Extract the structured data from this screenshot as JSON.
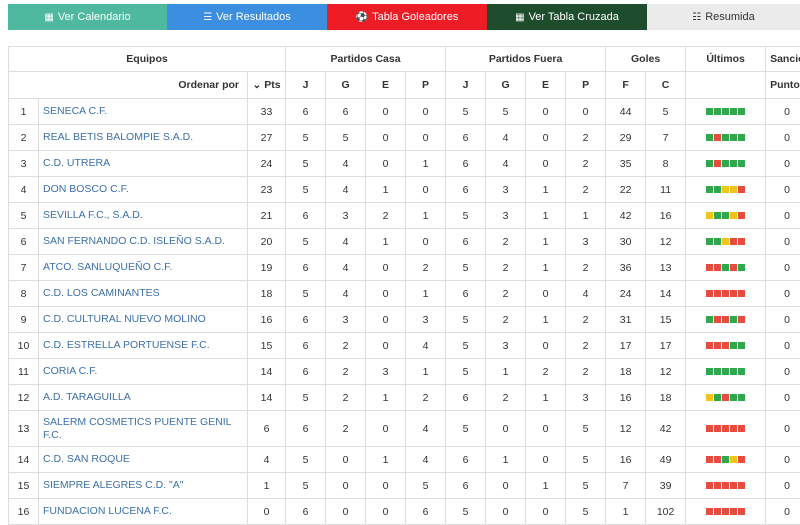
{
  "nav": [
    {
      "label": "Ver Calendario",
      "icon": "calendar-icon",
      "glyph": "▦"
    },
    {
      "label": "Ver Resultados",
      "icon": "list-icon",
      "glyph": "☰"
    },
    {
      "label": "Tabla Goleadores",
      "icon": "ball-icon",
      "glyph": "⚽"
    },
    {
      "label": "Ver Tabla Cruzada",
      "icon": "grid-icon",
      "glyph": "▦"
    },
    {
      "label": "Resumida",
      "icon": "list-alt-icon",
      "glyph": "☷"
    }
  ],
  "headers": {
    "equipos": "Equipos",
    "casa": "Partidos Casa",
    "fuera": "Partidos Fuera",
    "goles": "Goles",
    "ultimos": "Últimos",
    "sancion": "Sanción",
    "ordenar": "Ordenar por",
    "pts": "Pts",
    "sort_glyph": "⌄",
    "j": "J",
    "g": "G",
    "e": "E",
    "p": "P",
    "f": "F",
    "c": "C",
    "puntos": "Puntos"
  },
  "rows": [
    {
      "pos": "1",
      "team": "SENECA C.F.",
      "pts": "33",
      "hj": "6",
      "hg": "6",
      "he": "0",
      "hp": "0",
      "aj": "5",
      "ag": "5",
      "ae": "0",
      "ap": "0",
      "f": "44",
      "c": "5",
      "last": [
        "G",
        "G",
        "G",
        "G",
        "G"
      ],
      "san": "0"
    },
    {
      "pos": "2",
      "team": "REAL BETIS BALOMPIE S.A.D.",
      "pts": "27",
      "hj": "5",
      "hg": "5",
      "he": "0",
      "hp": "0",
      "aj": "6",
      "ag": "4",
      "ae": "0",
      "ap": "2",
      "f": "29",
      "c": "7",
      "last": [
        "G",
        "P",
        "G",
        "G",
        "G"
      ],
      "san": "0"
    },
    {
      "pos": "3",
      "team": "C.D. UTRERA",
      "pts": "24",
      "hj": "5",
      "hg": "4",
      "he": "0",
      "hp": "1",
      "aj": "6",
      "ag": "4",
      "ae": "0",
      "ap": "2",
      "f": "35",
      "c": "8",
      "last": [
        "G",
        "P",
        "G",
        "G",
        "G"
      ],
      "san": "0"
    },
    {
      "pos": "4",
      "team": "DON BOSCO C.F.",
      "pts": "23",
      "hj": "5",
      "hg": "4",
      "he": "1",
      "hp": "0",
      "aj": "6",
      "ag": "3",
      "ae": "1",
      "ap": "2",
      "f": "22",
      "c": "11",
      "last": [
        "G",
        "G",
        "E",
        "E",
        "P"
      ],
      "san": "0"
    },
    {
      "pos": "5",
      "team": "SEVILLA F.C., S.A.D.",
      "pts": "21",
      "hj": "6",
      "hg": "3",
      "he": "2",
      "hp": "1",
      "aj": "5",
      "ag": "3",
      "ae": "1",
      "ap": "1",
      "f": "42",
      "c": "16",
      "last": [
        "E",
        "G",
        "G",
        "E",
        "P"
      ],
      "san": "0"
    },
    {
      "pos": "6",
      "team": "SAN FERNANDO C.D. ISLEÑO S.A.D.",
      "pts": "20",
      "hj": "5",
      "hg": "4",
      "he": "1",
      "hp": "0",
      "aj": "6",
      "ag": "2",
      "ae": "1",
      "ap": "3",
      "f": "30",
      "c": "12",
      "last": [
        "G",
        "G",
        "E",
        "P",
        "P"
      ],
      "san": "0"
    },
    {
      "pos": "7",
      "team": "ATCO. SANLUQUEÑO C.F.",
      "pts": "19",
      "hj": "6",
      "hg": "4",
      "he": "0",
      "hp": "2",
      "aj": "5",
      "ag": "2",
      "ae": "1",
      "ap": "2",
      "f": "36",
      "c": "13",
      "last": [
        "P",
        "P",
        "G",
        "P",
        "G"
      ],
      "san": "0"
    },
    {
      "pos": "8",
      "team": "C.D. LOS CAMINANTES",
      "pts": "18",
      "hj": "5",
      "hg": "4",
      "he": "0",
      "hp": "1",
      "aj": "6",
      "ag": "2",
      "ae": "0",
      "ap": "4",
      "f": "24",
      "c": "14",
      "last": [
        "P",
        "P",
        "P",
        "P",
        "P"
      ],
      "san": "0"
    },
    {
      "pos": "9",
      "team": "C.D. CULTURAL NUEVO MOLINO",
      "pts": "16",
      "hj": "6",
      "hg": "3",
      "he": "0",
      "hp": "3",
      "aj": "5",
      "ag": "2",
      "ae": "1",
      "ap": "2",
      "f": "31",
      "c": "15",
      "last": [
        "G",
        "P",
        "P",
        "G",
        "P"
      ],
      "san": "0"
    },
    {
      "pos": "10",
      "team": "C.D. ESTRELLA PORTUENSE F.C.",
      "pts": "15",
      "hj": "6",
      "hg": "2",
      "he": "0",
      "hp": "4",
      "aj": "5",
      "ag": "3",
      "ae": "0",
      "ap": "2",
      "f": "17",
      "c": "17",
      "last": [
        "P",
        "P",
        "P",
        "G",
        "G"
      ],
      "san": "0"
    },
    {
      "pos": "11",
      "team": "CORIA C.F.",
      "pts": "14",
      "hj": "6",
      "hg": "2",
      "he": "3",
      "hp": "1",
      "aj": "5",
      "ag": "1",
      "ae": "2",
      "ap": "2",
      "f": "18",
      "c": "12",
      "last": [
        "G",
        "G",
        "G",
        "G",
        "G"
      ],
      "san": "0"
    },
    {
      "pos": "12",
      "team": "A.D. TARAGUILLA",
      "pts": "14",
      "hj": "5",
      "hg": "2",
      "he": "1",
      "hp": "2",
      "aj": "6",
      "ag": "2",
      "ae": "1",
      "ap": "3",
      "f": "16",
      "c": "18",
      "last": [
        "E",
        "G",
        "P",
        "G",
        "G"
      ],
      "san": "0"
    },
    {
      "pos": "13",
      "team": "SALERM COSMETICS PUENTE GENIL F.C.",
      "pts": "6",
      "hj": "6",
      "hg": "2",
      "he": "0",
      "hp": "4",
      "aj": "5",
      "ag": "0",
      "ae": "0",
      "ap": "5",
      "f": "12",
      "c": "42",
      "last": [
        "P",
        "P",
        "P",
        "P",
        "P"
      ],
      "san": "0"
    },
    {
      "pos": "14",
      "team": "C.D. SAN ROQUE",
      "pts": "4",
      "hj": "5",
      "hg": "0",
      "he": "1",
      "hp": "4",
      "aj": "6",
      "ag": "1",
      "ae": "0",
      "ap": "5",
      "f": "16",
      "c": "49",
      "last": [
        "P",
        "P",
        "G",
        "E",
        "P"
      ],
      "san": "0"
    },
    {
      "pos": "15",
      "team": "SIEMPRE ALEGRES C.D. \"A\"",
      "pts": "1",
      "hj": "5",
      "hg": "0",
      "he": "0",
      "hp": "5",
      "aj": "6",
      "ag": "0",
      "ae": "1",
      "ap": "5",
      "f": "7",
      "c": "39",
      "last": [
        "P",
        "P",
        "P",
        "P",
        "P"
      ],
      "san": "0"
    },
    {
      "pos": "16",
      "team": "FUNDACION LUCENA F.C.",
      "pts": "0",
      "hj": "6",
      "hg": "0",
      "he": "0",
      "hp": "6",
      "aj": "5",
      "ag": "0",
      "ae": "0",
      "ap": "5",
      "f": "1",
      "c": "102",
      "last": [
        "P",
        "P",
        "P",
        "P",
        "P"
      ],
      "san": "0"
    }
  ],
  "colors": {
    "G": "#2ea84a",
    "E": "#f0c419",
    "P": "#e64c3c"
  }
}
